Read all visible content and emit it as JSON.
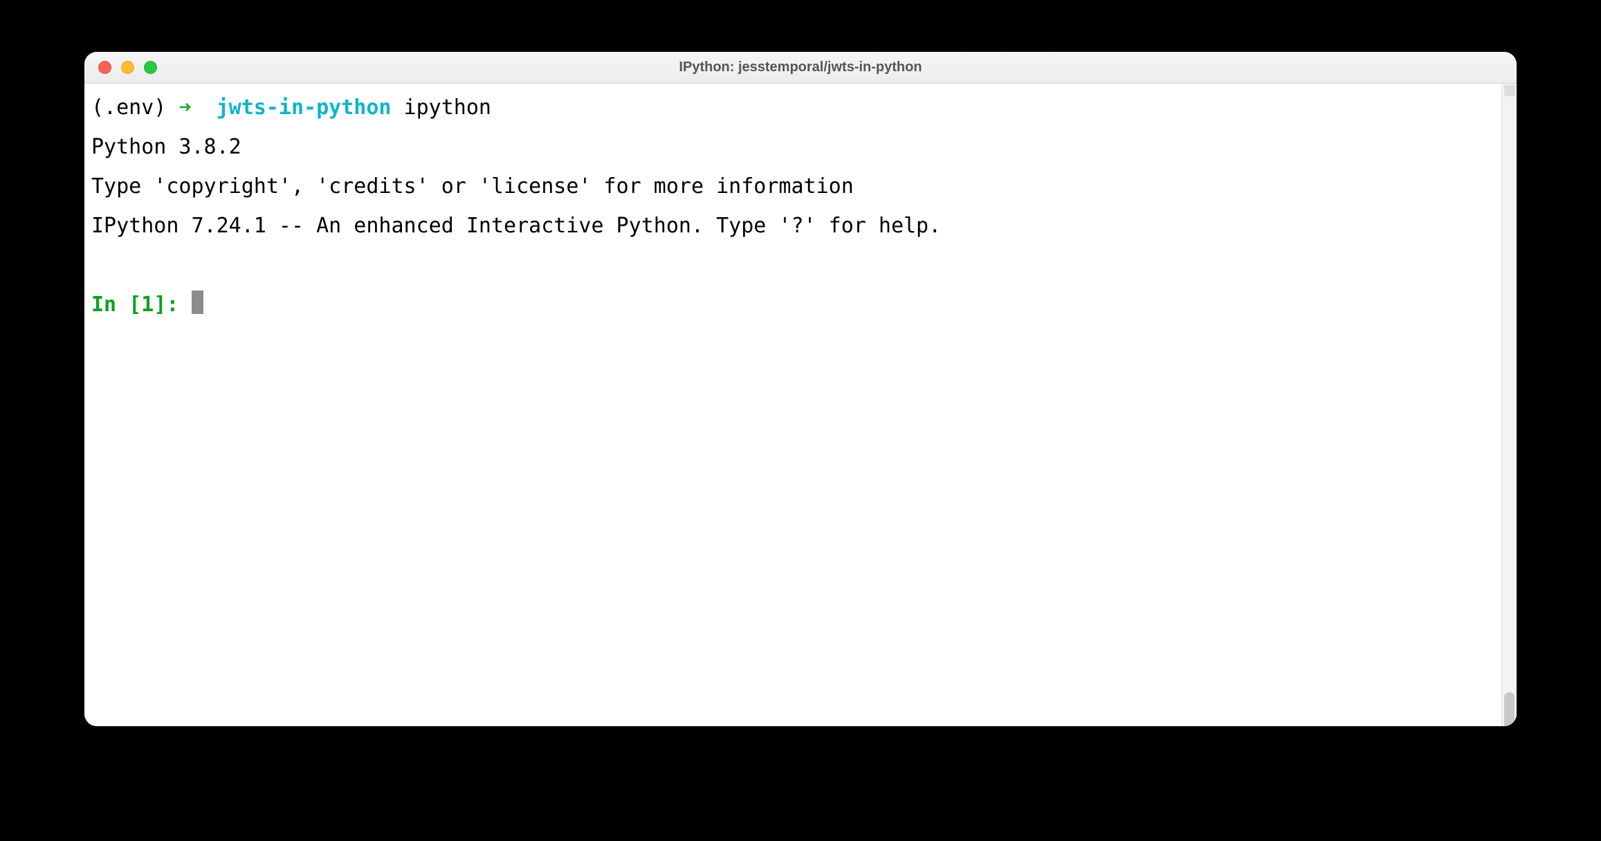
{
  "window": {
    "title": "IPython: jesstemporal/jwts-in-python"
  },
  "shell": {
    "venv": "(.env)",
    "arrow": "➜",
    "dirname": "jwts-in-python",
    "command": "ipython"
  },
  "output": {
    "line1": "Python 3.8.2",
    "line2": "Type 'copyright', 'credits' or 'license' for more information",
    "line3": "IPython 7.24.1 -- An enhanced Interactive Python. Type '?' for help."
  },
  "prompt": {
    "prefix": "In [",
    "num": "1",
    "suffix": "]: "
  }
}
